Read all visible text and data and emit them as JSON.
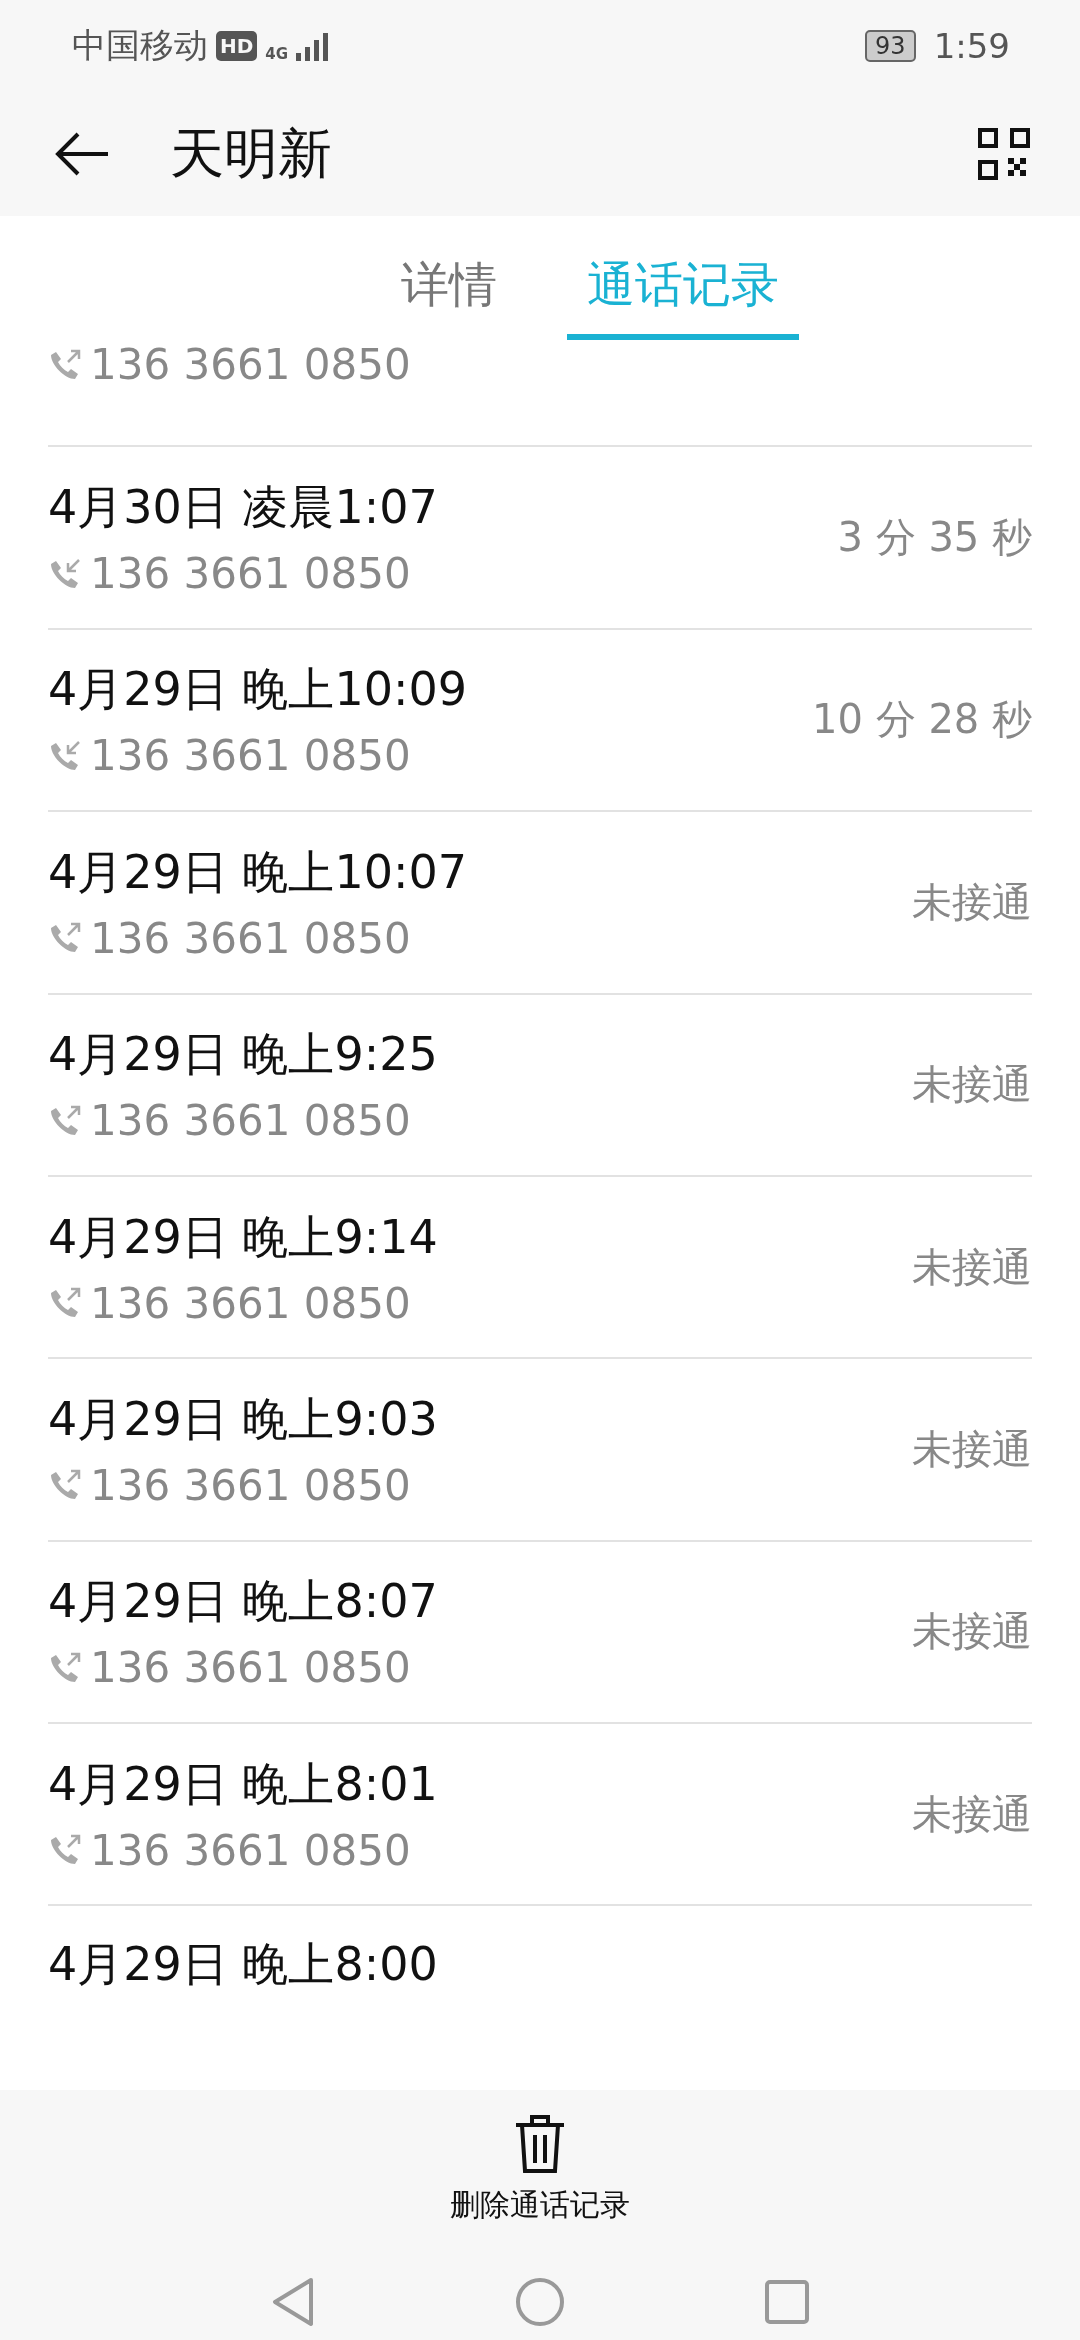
{
  "status_bar": {
    "carrier": "中国移动",
    "hd_badge": "HD",
    "network": "4G",
    "battery": "93",
    "time": "1:59"
  },
  "app_bar": {
    "title": "天明新"
  },
  "tabs": [
    {
      "label": "详情",
      "selected": false
    },
    {
      "label": "通话记录",
      "selected": true
    }
  ],
  "calls": [
    {
      "kind": "outgoing",
      "number": "136 3661 0850"
    },
    {
      "kind": "incoming",
      "time": "4月30日 凌晨1:07",
      "number": "136 3661 0850",
      "result": "3 分 35 秒"
    },
    {
      "kind": "incoming",
      "time": "4月29日 晚上10:09",
      "number": "136 3661 0850",
      "result": "10 分 28 秒"
    },
    {
      "kind": "outgoing",
      "time": "4月29日 晚上10:07",
      "number": "136 3661 0850",
      "result": "未接通"
    },
    {
      "kind": "outgoing",
      "time": "4月29日 晚上9:25",
      "number": "136 3661 0850",
      "result": "未接通"
    },
    {
      "kind": "outgoing",
      "time": "4月29日 晚上9:14",
      "number": "136 3661 0850",
      "result": "未接通"
    },
    {
      "kind": "outgoing",
      "time": "4月29日 晚上9:03",
      "number": "136 3661 0850",
      "result": "未接通"
    },
    {
      "kind": "outgoing",
      "time": "4月29日 晚上8:07",
      "number": "136 3661 0850",
      "result": "未接通"
    },
    {
      "kind": "outgoing",
      "time": "4月29日 晚上8:01",
      "number": "136 3661 0850",
      "result": "未接通"
    },
    {
      "time": "4月29日 晚上8:00"
    }
  ],
  "bottom_action": {
    "label": "删除通话记录"
  }
}
